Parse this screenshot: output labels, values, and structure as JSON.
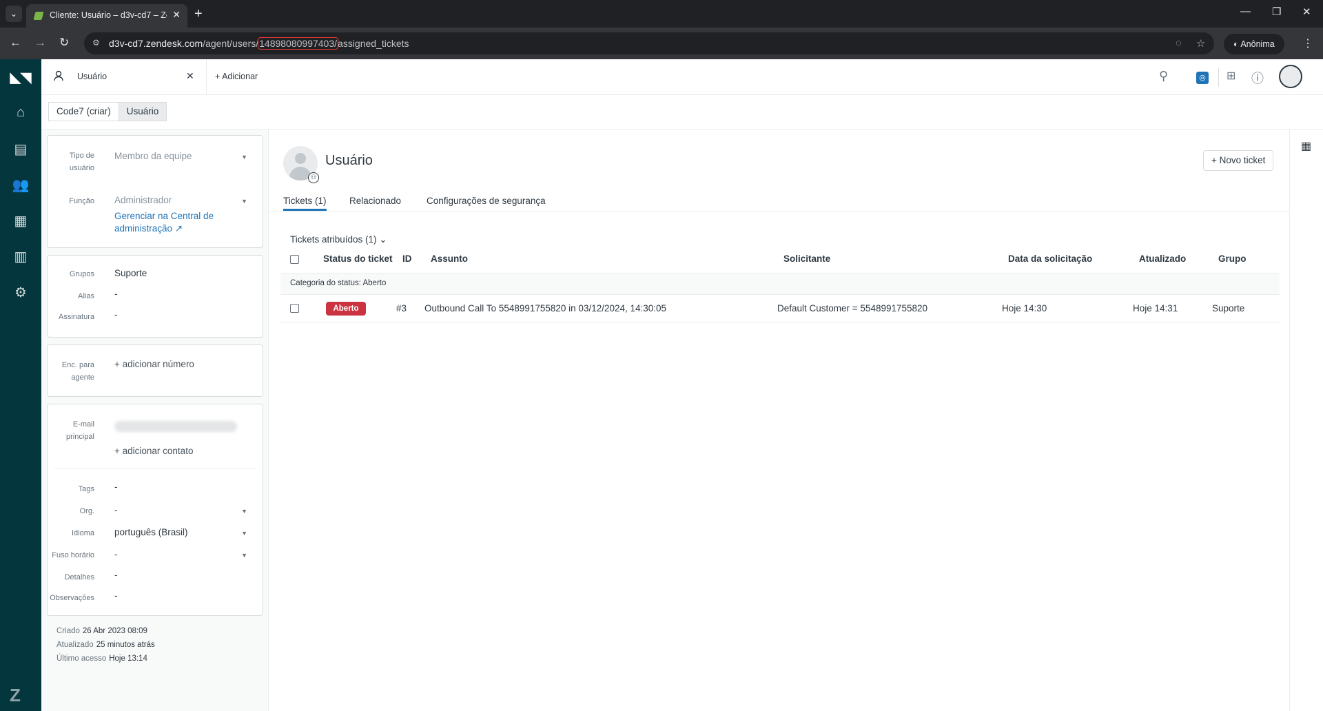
{
  "browser": {
    "tab_title": "Cliente: Usuário – d3v-cd7 – Zendesk",
    "url_host": "d3v-cd7.zendesk.com",
    "url_path_1": "/agent/users/",
    "url_id": "14898080997403/",
    "url_path_2": "assigned_tickets",
    "profile_label": "Anônima"
  },
  "topbar": {
    "workspace_tab": "Usuário",
    "add_label": "+ Adicionar"
  },
  "breadcrumb": [
    "Code7 (criar)",
    "Usuário"
  ],
  "left_panel": {
    "user_type_label": "Tipo de usuário",
    "user_type_value": "Membro da equipe",
    "role_label": "Função",
    "role_value": "Administrador",
    "manage_link": "Gerenciar na Central de administração",
    "groups_label": "Grupos",
    "groups_value": "Suporte",
    "alias_label": "Alias",
    "alias_value": "-",
    "signature_label": "Assinatura",
    "signature_value": "-",
    "forward_label": "Enc. para agente",
    "add_number": "+ adicionar número",
    "email_label": "E-mail principal",
    "add_contact": "+ adicionar contato",
    "tags_label": "Tags",
    "tags_value": "-",
    "org_label": "Org.",
    "org_value": "-",
    "language_label": "Idioma",
    "language_value": "português (Brasil)",
    "timezone_label": "Fuso horário",
    "timezone_value": "-",
    "details_label": "Detalhes",
    "details_value": "-",
    "notes_label": "Observações",
    "notes_value": "-",
    "created_label": "Criado",
    "created_value": "26 Abr 2023 08:09",
    "updated_label": "Atualizado",
    "updated_value": "25 minutos atrás",
    "last_access_label": "Último acesso",
    "last_access_value": "Hoje 13:14"
  },
  "main": {
    "user_name": "Usuário",
    "new_ticket": "+ Novo ticket",
    "tabs": [
      "Tickets (1)",
      "Relacionado",
      "Configurações de segurança"
    ],
    "view_title": "Tickets atribuídos (1) ⌄",
    "columns": [
      "Status do ticket",
      "ID",
      "Assunto",
      "Solicitante",
      "Data da solicitação",
      "Atualizado",
      "Grupo"
    ],
    "group_prefix": "Categoria do status: ",
    "group_value": "Aberto",
    "rows": [
      {
        "status": "Aberto",
        "id": "#3",
        "subject": "Outbound Call To 5548991755820 in 03/12/2024, 14:30:05",
        "requester": "Default Customer = 5548991755820",
        "requested": "Hoje 14:30",
        "updated": "Hoje 14:31",
        "group": "Suporte"
      }
    ]
  },
  "colors": {
    "nav_bg": "#03363d",
    "accent": "#1f73b7",
    "status_open": "#cc3340"
  }
}
